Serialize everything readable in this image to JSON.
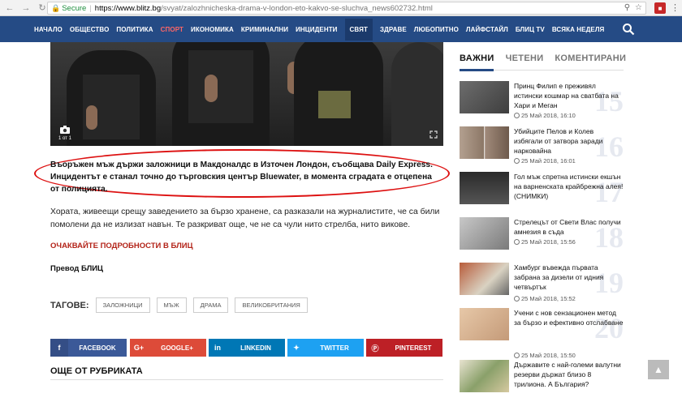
{
  "browser": {
    "secure_label": "Secure",
    "url_host": "https://www.blitz.bg",
    "url_path": "/svyat/zalozhnicheska-drama-v-london-eto-kakvo-se-sluchva_news602732.html"
  },
  "nav": {
    "items": [
      "НАЧАЛО",
      "ОБЩЕСТВО",
      "ПОЛИТИКА",
      "СПОРТ",
      "ИКОНОМИКА",
      "КРИМИНАЛНИ",
      "ИНЦИДЕНТИ",
      "СВЯТ",
      "ЗДРАВЕ",
      "ЛЮБОПИТНО",
      "ЛАЙФСТАЙЛ",
      "БЛИЦ TV",
      "ВСЯКА НЕДЕЛЯ"
    ]
  },
  "hero": {
    "photo_count": "1 от 1"
  },
  "article": {
    "lead": "Въоръжен мъж държи заложници в Макдоналдс в Източен Лондон, съобщава Daily Express. Инцидентът е станал точно до търговския център Bluewater, в момента сградата е отцепена от полицията.",
    "paragraph": "Хората, живеещи срещу заведението за бързо хранене, са разказали на журналистите, че са били помолени да не излизат навън. Те разкриват още, че не са чули нито стрелба, нито викове.",
    "expect_label": "ОЧАКВАЙТЕ ПОДРОБНОСТИ В БЛИЦ",
    "translation_label": "Превод БЛИЦ",
    "tags_label": "ТАГОВЕ:",
    "tags": [
      "ЗАЛОЖНИЦИ",
      "МЪЖ",
      "ДРАМА",
      "ВЕЛИКОБРИТАНИЯ"
    ]
  },
  "share": {
    "facebook": "FACEBOOK",
    "google": "GOOGLE+",
    "linkedin": "LINKEDIN",
    "twitter": "TWITTER",
    "pinterest": "PINTEREST",
    "google_icon_text": "G+"
  },
  "more_rubric": "ОЩЕ ОТ РУБРИКАТА",
  "sidebar": {
    "tabs": [
      "ВАЖНИ",
      "ЧЕТЕНИ",
      "КОМЕНТИРАНИ"
    ],
    "items": [
      {
        "title": "Принц Филип е преживял истински кошмар на сватбата на Хари и Меган",
        "date": "25 Май 2018, 16:10",
        "num": "15"
      },
      {
        "title": "Убийците Пелов и Колев избягали от затвора заради нарковайна",
        "date": "25 Май 2018, 16:01",
        "num": "16"
      },
      {
        "title": "Гол мъж спретна истински екшън на варненската крайбрежна алея! (СНИМКИ)",
        "date": "",
        "num": "17"
      },
      {
        "title": "Стрелецът от Свети Влас получи амнезия в съда",
        "date": "25 Май 2018, 15:56",
        "num": "18"
      },
      {
        "title": "Хамбург въвежда първата забрана за дизели от идния четвъртък",
        "date": "25 Май 2018, 15:52",
        "num": "19"
      },
      {
        "title": "Учени с нов сензационен метод за бързо и ефективно отслабване",
        "date": "25 Май 2018, 15:50",
        "num": "20"
      },
      {
        "title": "Държавите с най-големи валутни резерви държат близо 8 трилиона. А България?",
        "date": "",
        "num": ""
      }
    ]
  }
}
